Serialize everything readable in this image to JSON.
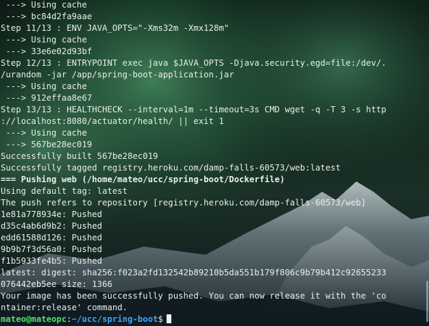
{
  "terminal": {
    "lines": [
      [
        {
          "t": " ---> Using cache"
        }
      ],
      [
        {
          "t": " ---> bc84d2fa9aae"
        }
      ],
      [
        {
          "t": "Step 11/13 : ENV JAVA_OPTS=\"-Xms32m -Xmx128m\""
        }
      ],
      [
        {
          "t": " ---> Using cache"
        }
      ],
      [
        {
          "t": " ---> 33e6e02d93bf"
        }
      ],
      [
        {
          "t": "Step 12/13 : ENTRYPOINT exec java $JAVA_OPTS -Djava.security.egd=file:/dev/."
        }
      ],
      [
        {
          "t": "/urandom -jar /app/spring-boot-application.jar"
        }
      ],
      [
        {
          "t": " ---> Using cache"
        }
      ],
      [
        {
          "t": " ---> 912effaa8e67"
        }
      ],
      [
        {
          "t": "Step 13/13 : HEALTHCHECK --interval=1m --timeout=3s CMD wget -q -T 3 -s http"
        }
      ],
      [
        {
          "t": "://localhost:8080/actuator/health/ || exit 1"
        }
      ],
      [
        {
          "t": " ---> Using cache"
        }
      ],
      [
        {
          "t": " ---> 567be28ec019"
        }
      ],
      [
        {
          "t": "Successfully built 567be28ec019"
        }
      ],
      [
        {
          "t": "Successfully tagged registry.heroku.com/damp-falls-60573/web:latest"
        }
      ],
      [
        {
          "t": "=== ",
          "c": "hdr"
        },
        {
          "t": "Pushing web (/home/mateo/ucc/spring-boot/Dockerfile)",
          "c": "bold"
        }
      ],
      [
        {
          "t": "Using default tag: latest"
        }
      ],
      [
        {
          "t": "The push refers to repository [registry.heroku.com/damp-falls-60573/web]"
        }
      ],
      [
        {
          "t": "1e81a778934e: Pushed"
        }
      ],
      [
        {
          "t": "d35c4ab6d9b2: Pushed"
        }
      ],
      [
        {
          "t": "edd61588d126: Pushed"
        }
      ],
      [
        {
          "t": "9b9b7f3d56a0: Pushed"
        }
      ],
      [
        {
          "t": "f1b5933fe4b5: Pushed"
        }
      ],
      [
        {
          "t": "latest: digest: sha256:f023a2fd132542b89210b5da551b179f806c9b79b412c92655233"
        }
      ],
      [
        {
          "t": "076442eb5ee size: 1366"
        }
      ],
      [
        {
          "t": "Your image has been successfully pushed. You can now release it with the 'co"
        }
      ],
      [
        {
          "t": "ntainer:release' command."
        }
      ]
    ],
    "prompt": {
      "user_host": "mateo@mateopc",
      "sep": ":",
      "path": "~/ucc/spring-boot",
      "symbol": "$"
    }
  },
  "colors": {
    "text": "#e9eee9",
    "prompt_user": "#4ce06a",
    "prompt_path": "#3aa6ff",
    "aurora": "#3f8f5e",
    "sky": "#0b1712"
  }
}
